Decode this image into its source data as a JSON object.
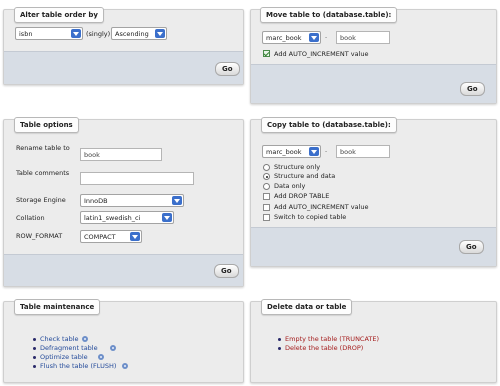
{
  "alter_order": {
    "legend": "Alter table order by",
    "column": "isbn",
    "singly": "(singly)",
    "order": "Ascending",
    "go": "Go"
  },
  "move_table": {
    "legend": "Move table to (database.table):",
    "database": "marc_book",
    "dot": "·",
    "table": "book",
    "auto_increment_label": "Add AUTO_INCREMENT value",
    "auto_increment_checked": true,
    "go": "Go"
  },
  "table_options": {
    "legend": "Table options",
    "rename_label": "Rename table to",
    "rename_value": "book",
    "comments_label": "Table comments",
    "comments_value": "",
    "engine_label": "Storage Engine",
    "engine_value": "InnoDB",
    "collation_label": "Collation",
    "collation_value": "latin1_swedish_ci",
    "row_format_label": "ROW_FORMAT",
    "row_format_value": "COMPACT",
    "go": "Go"
  },
  "copy_table": {
    "legend": "Copy table to (database.table):",
    "database": "marc_book",
    "dot": "·",
    "table": "book",
    "structure_only": "Structure only",
    "structure_and_data": "Structure and data",
    "data_only": "Data only",
    "selected": "structure_and_data",
    "add_drop_table": "Add DROP TABLE",
    "add_auto_increment": "Add AUTO_INCREMENT value",
    "switch_to_copied": "Switch to copied table",
    "go": "Go"
  },
  "maintenance": {
    "legend": "Table maintenance",
    "items": [
      "Check table",
      "Defragment table",
      "Optimize table",
      "Flush the table (FLUSH)"
    ]
  },
  "delete": {
    "legend": "Delete data or table",
    "items": [
      "Empty the table (TRUNCATE)",
      "Delete the table (DROP)"
    ]
  },
  "colors": {
    "panel_bg": "#ececec",
    "footer_bg": "#d7dde5",
    "link": "#234a9a",
    "danger_link": "#a41b1b",
    "select_arrow": "#3b6fcb"
  },
  "icons": [
    "dropdown-arrow-icon",
    "help-icon",
    "bullet-icon",
    "checkbox-icon",
    "radio-icon"
  ]
}
